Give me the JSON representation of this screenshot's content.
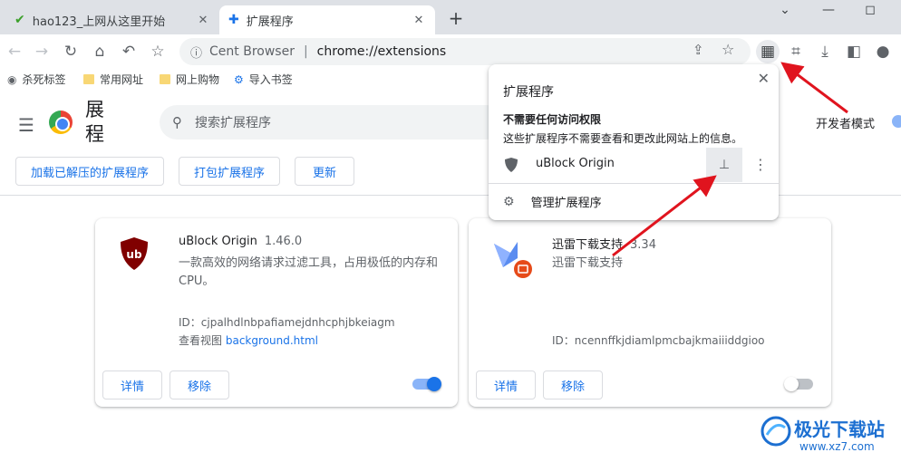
{
  "tabs": [
    {
      "label": "hao123_上网从这里开始",
      "active": false
    },
    {
      "label": "扩展程序",
      "active": true
    }
  ],
  "window_controls": {
    "minimize": "—",
    "restore": "◻",
    "collapse": "⌄"
  },
  "toolbar": {
    "omnibox_site": "Cent Browser",
    "omnibox_url": "chrome://extensions"
  },
  "bookmarks": [
    {
      "label": "杀死标签",
      "icon": "globe-icon"
    },
    {
      "label": "常用网址",
      "icon": "folder-icon"
    },
    {
      "label": "网上购物",
      "icon": "folder-icon"
    },
    {
      "label": "导入书签",
      "icon": "gear-icon"
    }
  ],
  "header": {
    "title": "扩展程序",
    "title_visible": "展程",
    "search_placeholder": "搜索扩展程序",
    "dev_mode_label": "开发者模式",
    "buttons": [
      "加载已解压的扩展程序",
      "打包扩展程序",
      "更新"
    ]
  },
  "extensions": [
    {
      "name": "uBlock Origin",
      "version": "1.46.0",
      "description": "一款高效的网络请求过滤工具，占用极低的内存和CPU。",
      "id": "ID：cjpalhdlnbpafiamejdnhcphjbkeiagm",
      "view_label": "查看视图",
      "view_link": "background.html",
      "details_label": "详情",
      "remove_label": "移除",
      "enabled": true,
      "icon": "ublock-shield-icon"
    },
    {
      "name": "迅雷下载支持",
      "version": "3.34",
      "description": "迅雷下载支持",
      "id": "ID：ncennffkjdiamlpmcbajkmaiiiddgioo",
      "details_label": "详情",
      "remove_label": "移除",
      "enabled": false,
      "icon": "xunlei-bird-icon"
    }
  ],
  "popup": {
    "title": "扩展程序",
    "section_title": "不需要任何访问权限",
    "section_subtitle": "这些扩展程序不需要查看和更改此网站上的信息。",
    "item_name": "uBlock Origin",
    "manage_label": "管理扩展程序"
  },
  "watermark": {
    "brand": "极光下载站",
    "site": "www.xz7.com"
  },
  "colors": {
    "accent": "#1a73e8",
    "arrow": "#e0141e",
    "tab_strip": "#dee1e6"
  }
}
